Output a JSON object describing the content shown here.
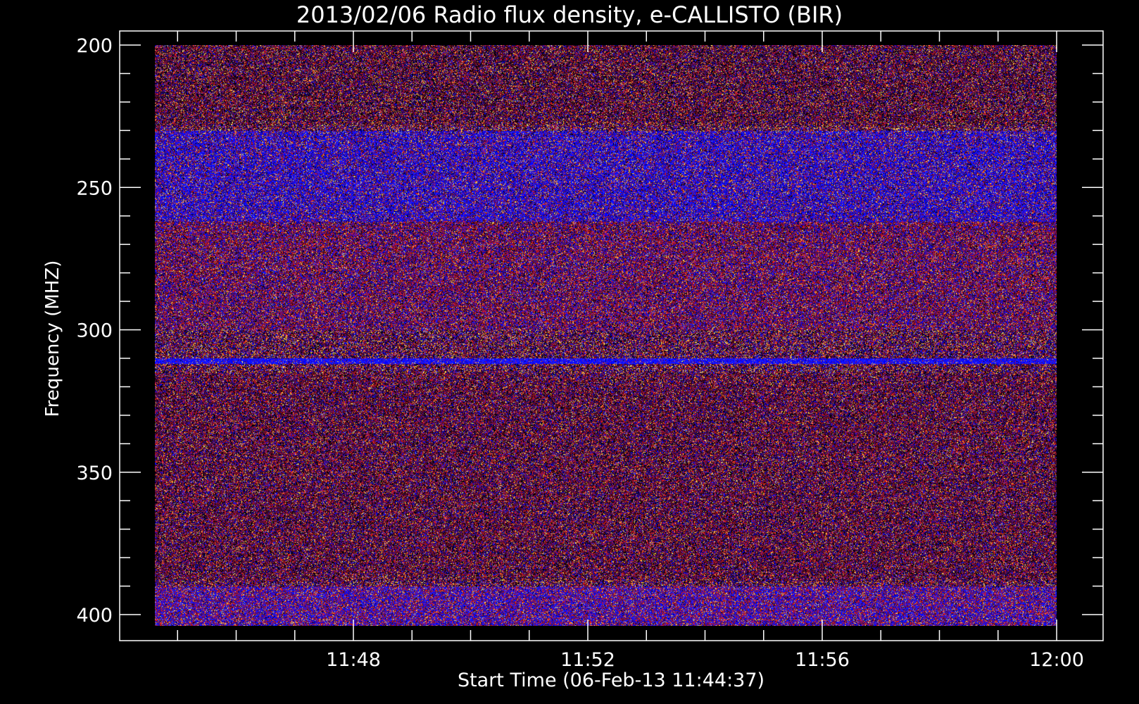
{
  "chart_data": {
    "type": "heatmap",
    "title": "2013/02/06  Radio flux density, e-CALLISTO (BIR)",
    "xlabel": "Start Time (06-Feb-13 11:44:37)",
    "ylabel": "Frequency (MHZ)",
    "x_axis": {
      "unit": "time",
      "range": [
        "11:44:37",
        "12:00:00"
      ],
      "ticks": [
        {
          "value": "11:48",
          "label": "11:48"
        },
        {
          "value": "11:52",
          "label": "11:52"
        },
        {
          "value": "11:56",
          "label": "11:56"
        },
        {
          "value": "12:00",
          "label": "12:00"
        }
      ],
      "minor_tick_step_minutes": 1
    },
    "y_axis": {
      "unit": "MHz",
      "range": [
        195,
        404
      ],
      "inverted": true,
      "ticks": [
        200,
        250,
        300,
        350,
        400
      ],
      "minor_tick_step": 10
    },
    "data_extent": {
      "time_start": "11:44:37",
      "time_end": "12:00:00",
      "freq_start": 200,
      "freq_end": 404
    },
    "colormap": [
      "#000000",
      "#3a0a4a",
      "#7a1030",
      "#c01818",
      "#ff2020",
      "#2020ff",
      "#0000ff",
      "#ffc040",
      "#ffff60"
    ],
    "features": [
      {
        "freq_range": [
          230,
          262
        ],
        "note": "enhanced blue band"
      },
      {
        "freq_range": [
          310,
          312
        ],
        "note": "narrow blue interference line"
      },
      {
        "freq_range": [
          390,
          404
        ],
        "note": "mixed red/blue band"
      }
    ],
    "grid": false,
    "legend": "none"
  }
}
